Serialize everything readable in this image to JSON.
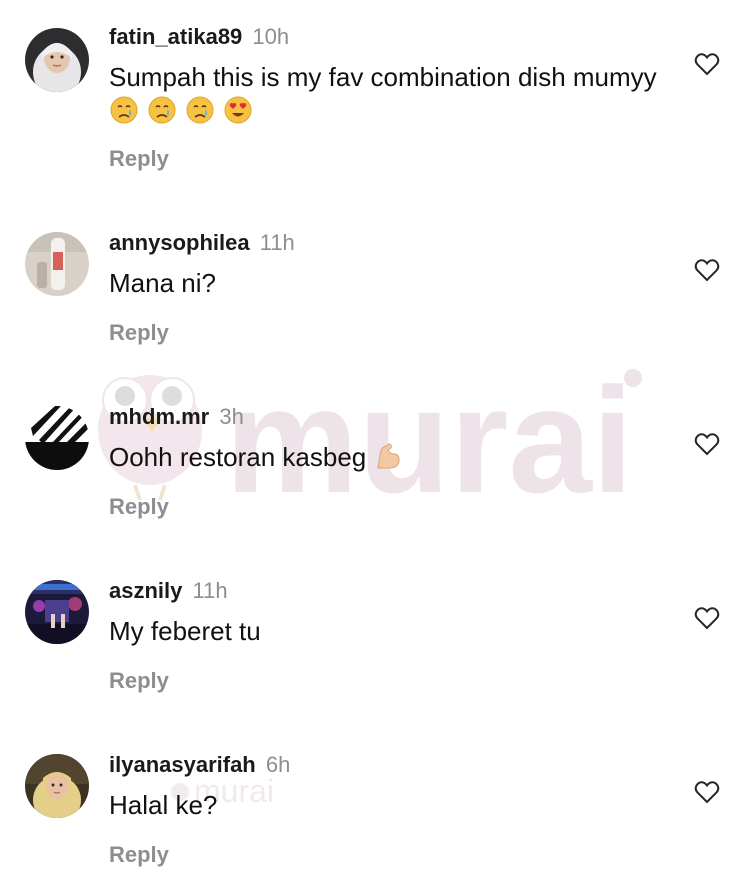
{
  "watermark": {
    "text": "murai",
    "color": "#e9dde3"
  },
  "colors": {
    "username": "#1a1a1a",
    "meta": "#8e8e8e",
    "text": "#111111"
  },
  "comments": [
    {
      "username": "fatin_atika89",
      "time": "10h",
      "text": "Sumpah this is my fav combination dish mumyy",
      "emojis": [
        "crying-face",
        "crying-face",
        "crying-face",
        "heart-eyes-face"
      ],
      "reply_label": "Reply",
      "avatar": "hijab-woman-avatar"
    },
    {
      "username": "annysophilea",
      "time": "11h",
      "text": "Mana ni?",
      "reply_label": "Reply",
      "avatar": "bottle-avatar"
    },
    {
      "username": "mhdm.mr",
      "time": "3h",
      "text": "Oohh restoran kasbeg",
      "emojis": [
        "flexed-biceps"
      ],
      "reply_label": "Reply",
      "avatar": "zebra-pattern-avatar"
    },
    {
      "username": "asznily",
      "time": "11h",
      "text": "My feberet tu",
      "reply_label": "Reply",
      "avatar": "concert-stage-avatar"
    },
    {
      "username": "ilyanasyarifah",
      "time": "6h",
      "text": "Halal ke?",
      "reply_label": "Reply",
      "avatar": "hijab-girl-avatar"
    }
  ]
}
